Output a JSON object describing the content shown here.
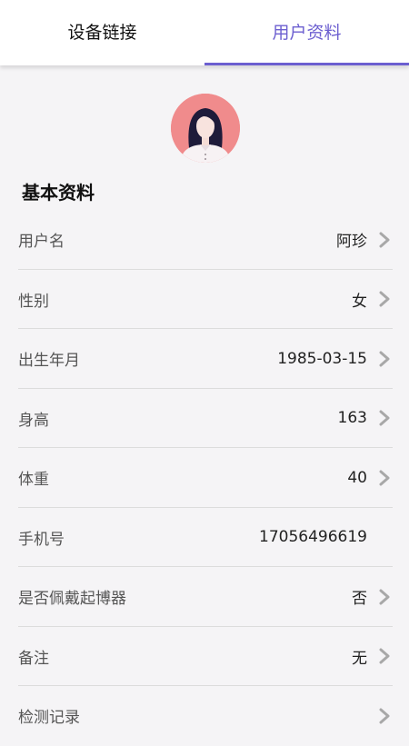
{
  "tabs": [
    {
      "label": "设备链接",
      "active": false
    },
    {
      "label": "用户资料",
      "active": true
    }
  ],
  "accent_color": "#6c5fd0",
  "avatar": {
    "icon": "female-avatar-icon",
    "background": "#f08b8c"
  },
  "section_title": "基本资料",
  "rows": [
    {
      "label": "用户名",
      "value": "阿珍",
      "chevron": true
    },
    {
      "label": "性别",
      "value": "女",
      "chevron": true
    },
    {
      "label": "出生年月",
      "value": "1985-03-15",
      "chevron": true
    },
    {
      "label": "身高",
      "value": "163",
      "chevron": true
    },
    {
      "label": "体重",
      "value": "40",
      "chevron": true
    },
    {
      "label": "手机号",
      "value": "17056496619",
      "chevron": false
    },
    {
      "label": "是否佩戴起博器",
      "value": "否",
      "chevron": true
    },
    {
      "label": "备注",
      "value": "无",
      "chevron": true
    },
    {
      "label": "检测记录",
      "value": "",
      "chevron": true
    }
  ]
}
